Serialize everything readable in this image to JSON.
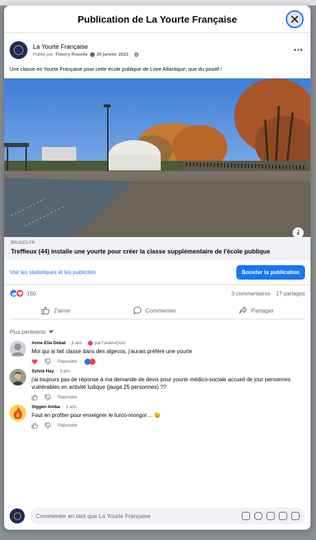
{
  "modal": {
    "title": "Publication de La Yourte Française"
  },
  "post": {
    "page_name": "La Yourte Française",
    "published_by_prefix": "Publié par",
    "author": "Thierry Rouelle",
    "date": "26 janvier 2023",
    "text": "Une classe en Yourte Française pour cette école publique de Loire Atlantique,  que du positif !"
  },
  "link": {
    "domain": "BRUDED.FR",
    "title": "Treffieux (44) installe une yourte pour créer la classe supplémentaire de l'école publique"
  },
  "stats": {
    "link_label": "Voir les statistiques et les publicités",
    "boost_label": "Booster la publication"
  },
  "reactions": {
    "count": "160",
    "comments": "3 commentaires",
    "shares": "17 partages"
  },
  "actions": {
    "like": "J'aime",
    "comment": "Commenter",
    "share": "Partager"
  },
  "sort": {
    "label": "Plus pertinents"
  },
  "comments": [
    {
      "name": "Anne Elia Debat",
      "time": "3 ans",
      "liked_by_author": "par l'auteur(ice)",
      "text": "Moi qui ai fait classe dans des algecos, j'aurais préféré une yourte",
      "reply": "Répondre"
    },
    {
      "name": "Sylvia Hay",
      "time": "3 ans",
      "text": "j'ai toujours pas de réponse à ma demande de devis pour yourte médico-sociale accueil de jour personnes vulnérables en activité ludique (jauge 25 personnes) ??",
      "reply": "Répondre"
    },
    {
      "name": "Siggen Amba",
      "time": "3 ans",
      "text": "Faut en profiter pour enseigner le turco-mongol ... 😉",
      "reply": "Répondre"
    }
  ],
  "composer": {
    "placeholder": "Commenter en tant que La Yourte Française"
  },
  "colors": {
    "accent": "#1877f2",
    "love": "#f33e58",
    "muted": "#65676b"
  }
}
